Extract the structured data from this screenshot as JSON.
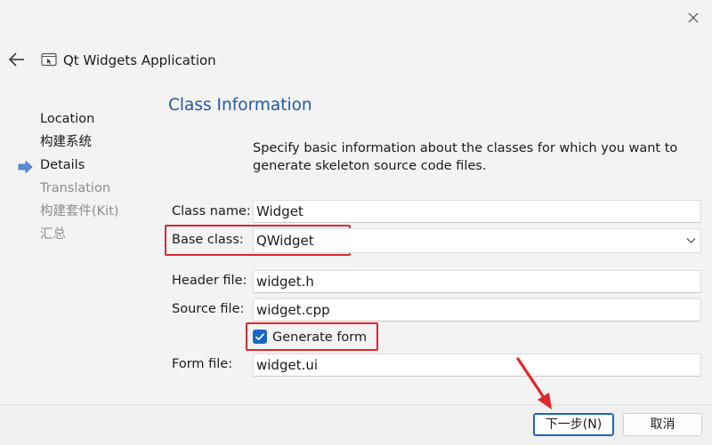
{
  "window": {
    "title": "Qt Widgets Application"
  },
  "steps": [
    {
      "label": "Location",
      "state": "done"
    },
    {
      "label": "构建系统",
      "state": "done"
    },
    {
      "label": "Details",
      "state": "current"
    },
    {
      "label": "Translation",
      "state": "pending"
    },
    {
      "label": "构建套件(Kit)",
      "state": "pending"
    },
    {
      "label": "汇总",
      "state": "pending"
    }
  ],
  "page": {
    "title": "Class Information",
    "description": "Specify basic information about the classes for which you want to generate skeleton source code files."
  },
  "form": {
    "class_name": {
      "label": "Class name:",
      "value": "Widget"
    },
    "base_class": {
      "label": "Base class:",
      "value": "QWidget"
    },
    "header_file": {
      "label": "Header file:",
      "value": "widget.h"
    },
    "source_file": {
      "label": "Source file:",
      "value": "widget.cpp"
    },
    "generate_form": {
      "label": "Generate form",
      "checked": true
    },
    "form_file": {
      "label": "Form file:",
      "value": "widget.ui"
    }
  },
  "buttons": {
    "next": "下一步(N)",
    "cancel": "取消"
  },
  "colors": {
    "accent": "#1a66c2",
    "title_blue": "#1f5aa6",
    "highlight_red": "#e0262b",
    "pending_gray": "#8d8d8d"
  },
  "icons": {
    "close": "close-icon",
    "back": "back-arrow-icon",
    "wizard": "application-window-icon",
    "step_marker": "current-step-arrow-icon",
    "dropdown": "chevron-down-icon",
    "check": "checkmark-icon"
  }
}
